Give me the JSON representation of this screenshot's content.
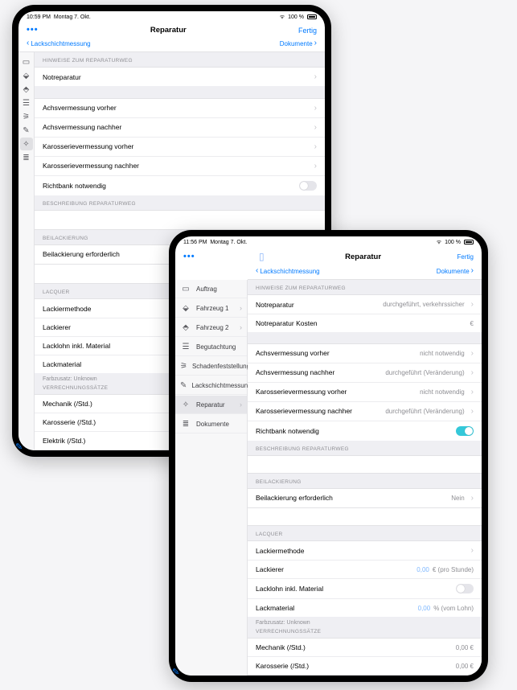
{
  "status": {
    "time1": "10:59 PM",
    "time2": "11:56 PM",
    "date": "Montag 7. Okt.",
    "wifi": "100 %"
  },
  "header": {
    "title": "Reparatur",
    "done": "Fertig",
    "back": "Lackschichtmessung",
    "forward": "Dokumente",
    "dots": "•••"
  },
  "sidebar1": {
    "icons": [
      "folder-icon",
      "car-icon",
      "car2-icon",
      "clipboard-icon",
      "damage-icon",
      "paint-icon",
      "wrench-icon",
      "doc-icon"
    ],
    "activeIndex": 6
  },
  "sidebar2": {
    "items": [
      {
        "icon": "folder-icon",
        "label": "Auftrag"
      },
      {
        "icon": "car-icon",
        "label": "Fahrzeug 1",
        "chev": true
      },
      {
        "icon": "car2-icon",
        "label": "Fahrzeug 2",
        "chev": true
      },
      {
        "icon": "clipboard-icon",
        "label": "Begutachtung"
      },
      {
        "icon": "damage-icon",
        "label": "Schadenfeststellung",
        "chev": true
      },
      {
        "icon": "paint-icon",
        "label": "Lackschichtmessung"
      },
      {
        "icon": "wrench-icon",
        "label": "Reparatur",
        "chev": true
      },
      {
        "icon": "doc-icon",
        "label": "Dokumente"
      }
    ],
    "activeIndex": 6
  },
  "sections": {
    "hinweise": "HINWEISE ZUM REPARATURWEG",
    "beschreibung": "BESCHREIBUNG REPARATURWEG",
    "beilackierung": "BEILACKIERUNG",
    "lacquer": "LACQUER",
    "verrechnung": "VERRECHNUNGSSÄTZE"
  },
  "rows1": {
    "notreparatur": "Notreparatur",
    "achs_vor": "Achsvermessung vorher",
    "achs_nach": "Achsvermessung nachher",
    "kaross_vor": "Karosserievermessung vorher",
    "kaross_nach": "Karosserievermessung nachher",
    "richtbank": "Richtbank notwendig",
    "beilack_erf": "Beilackierung erforderlich",
    "lackiermethode": "Lackiermethode",
    "lackierer": "Lackierer",
    "lacklohn": "Lacklohn inkl. Material",
    "lackmaterial": "Lackmaterial",
    "farbzusatz": "Farbzusatz: Unknown",
    "mechanik": "Mechanik (/Std.)",
    "karosserie": "Karosserie (/Std.)",
    "elektrik": "Elektrik (/Std.)"
  },
  "rows2": {
    "notreparatur": "Notreparatur",
    "notreparatur_val": "durchgeführt, verkehrssicher",
    "notreparatur_kosten": "Notreparatur Kosten",
    "notreparatur_kosten_val": "€",
    "achs_vor": "Achsvermessung vorher",
    "achs_vor_val": "nicht notwendig",
    "achs_nach": "Achsvermessung nachher",
    "achs_nach_val": "durchgeführt (Veränderung)",
    "kaross_vor": "Karosserievermessung vorher",
    "kaross_vor_val": "nicht notwendig",
    "kaross_nach": "Karosserievermessung nachher",
    "kaross_nach_val": "durchgeführt (Veränderung)",
    "richtbank": "Richtbank notwendig",
    "beilack_erf": "Beilackierung erforderlich",
    "beilack_erf_val": "Nein",
    "lackiermethode": "Lackiermethode",
    "lackierer": "Lackierer",
    "lackierer_val": "0,00",
    "lackierer_unit": "€ (pro Stunde)",
    "lacklohn": "Lacklohn inkl. Material",
    "lackmaterial": "Lackmaterial",
    "lackmaterial_val": "0,00",
    "lackmaterial_unit": "% (vom Lohn)",
    "farbzusatz": "Farbzusatz: Unknown",
    "mechanik": "Mechanik (/Std.)",
    "mechanik_val": "0,00 €",
    "karosserie": "Karosserie (/Std.)",
    "karosserie_val": "0,00 €"
  },
  "icons": {
    "folder-icon": "▭",
    "car-icon": "⬙",
    "car2-icon": "⬘",
    "clipboard-icon": "☰",
    "damage-icon": "⚞",
    "paint-icon": "✎",
    "wrench-icon": "✧",
    "doc-icon": "≣"
  }
}
